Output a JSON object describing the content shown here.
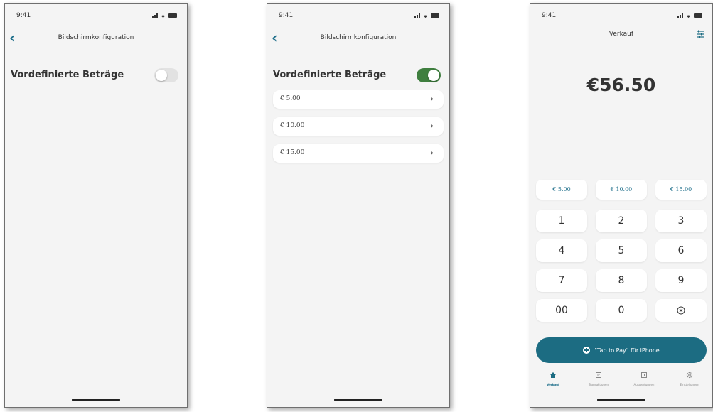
{
  "status": {
    "time": "9:41"
  },
  "screen_config": {
    "back_icon": "chevron-left-icon",
    "title": "Bildschirmkonfiguration",
    "setting_label": "Vordefinierte Beträge",
    "toggle_off": false,
    "toggle_on": true,
    "amounts": [
      {
        "label": "€ 5.00",
        "chevron": "›"
      },
      {
        "label": "€ 10.00",
        "chevron": "›"
      },
      {
        "label": "€ 15.00",
        "chevron": "›"
      }
    ]
  },
  "sale": {
    "title": "Verkauf",
    "total": "€56.50",
    "presets": [
      "€ 5.00",
      "€ 10.00",
      "€ 15.00"
    ],
    "keypad": [
      [
        "1",
        "2",
        "3"
      ],
      [
        "4",
        "5",
        "6"
      ],
      [
        "7",
        "8",
        "9"
      ],
      [
        "00",
        "0",
        "backspace-icon"
      ]
    ],
    "tap_button": "\"Tap to Pay\" für iPhone",
    "tabs": [
      {
        "label": "Verkauf",
        "icon": "home-icon",
        "active": true
      },
      {
        "label": "Transaktionen",
        "icon": "receipt-icon",
        "active": false
      },
      {
        "label": "Auswertungen",
        "icon": "chart-icon",
        "active": false
      },
      {
        "label": "Einstellungen",
        "icon": "gear-icon",
        "active": false
      }
    ]
  },
  "colors": {
    "accent": "#1c6c82",
    "toggle_on": "#3f7f3f",
    "toggle_off": "#e2e2e2",
    "background": "#f4f4f4"
  }
}
